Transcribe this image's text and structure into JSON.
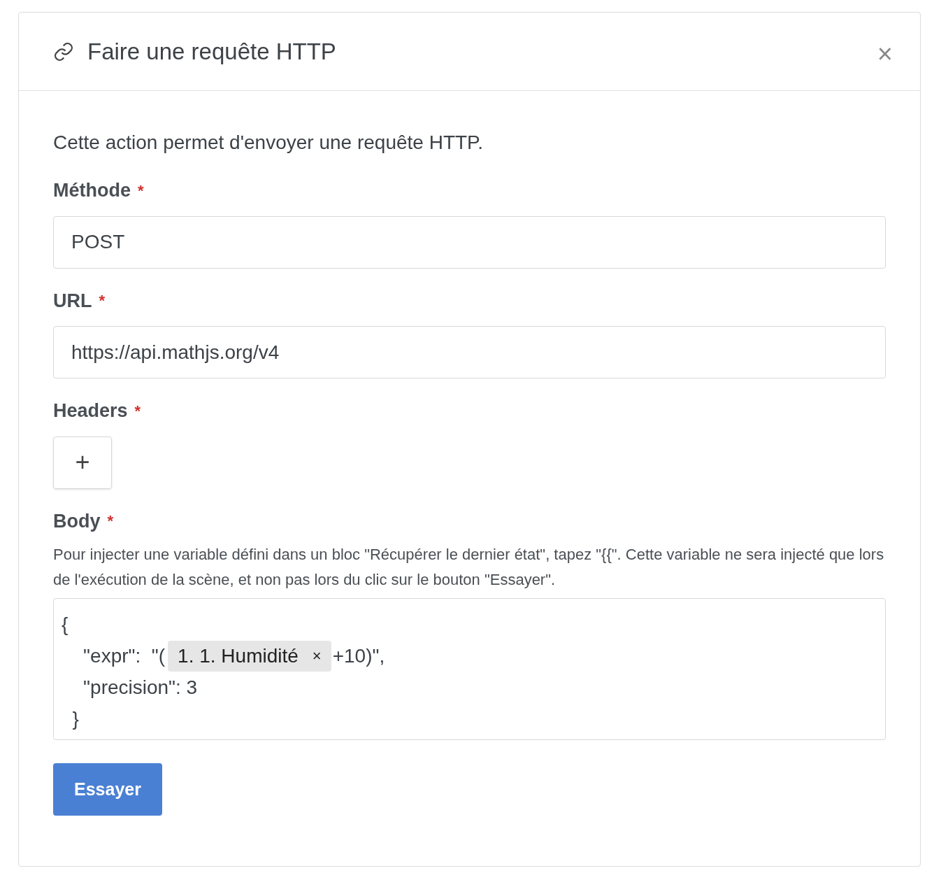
{
  "dialog": {
    "title": "Faire une requête HTTP",
    "close": "×"
  },
  "description": "Cette action permet d'envoyer une requête HTTP.",
  "fields": [
    {
      "kind": "input",
      "label": "Méthode",
      "required_mark": "*",
      "value": "POST"
    },
    {
      "kind": "input",
      "label": "URL",
      "required_mark": "*",
      "value": "https://api.mathjs.org/v4"
    },
    {
      "kind": "add",
      "label": "Headers",
      "required_mark": "*",
      "button": "+"
    },
    {
      "kind": "editor",
      "label": "Body",
      "required_mark": "*",
      "hint": "Pour injecter une variable défini dans un bloc \"Récupérer le dernier état\", tapez \"{{\". Cette variable ne sera injecté que lors de l'exécution de la scène, et non pas lors du clic sur le bouton \"Essayer\".",
      "lines": [
        [
          {
            "kind": "text",
            "text": "{"
          }
        ],
        [
          {
            "kind": "text",
            "text": "    \"expr\":  \"("
          },
          {
            "kind": "tag",
            "text": "1. 1. Humidité",
            "remove": "×"
          },
          {
            "kind": "text",
            "text": "+10)\","
          }
        ],
        [
          {
            "kind": "text",
            "text": "    \"precision\": 3"
          }
        ],
        [
          {
            "kind": "text",
            "text": "  }"
          }
        ]
      ]
    }
  ],
  "submit": "Essayer"
}
